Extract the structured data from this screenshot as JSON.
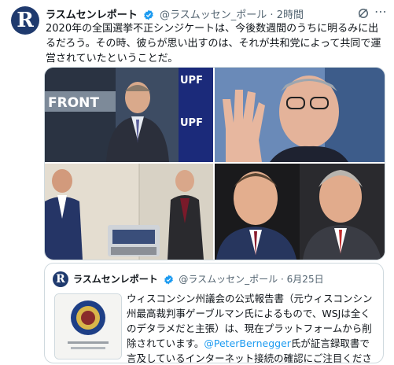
{
  "tweet": {
    "avatar_letter": "R",
    "display_name": "ラスムセンレポート",
    "handle": "@ラスムッセン_ポール",
    "separator": "·",
    "time": "2時間",
    "text": "2020年の全国選挙不正シンジケートは、今後数週間のうちに明るみに出るだろう。その時、彼らが思い出すのは、それが共和党によって共同で運営されていたということだ。",
    "photo_label_front": "FRONT",
    "photo_label_upf": "UPF"
  },
  "quote": {
    "avatar_letter": "R",
    "display_name": "ラスムセンレポート",
    "handle": "@ラスムッセン_ポール",
    "separator": "·",
    "date": "6月25日",
    "text_before_mention": "ウィスコンシン州議会の公式報告書（元ウィスコンシン州最高裁判事ゲーブルマン氏によるもので、WSJは全くのデタラメだと主張）は、現在プラットフォームから削除されています。",
    "mention": "@PeterBernegger",
    "text_after_mention": "氏が証言録取書で言及しているインターネット接続の確認にご注目ください..."
  },
  "colors": {
    "accent": "#1d9bf0",
    "text": "#0f1419",
    "muted": "#536471",
    "border": "#cfd9de"
  }
}
